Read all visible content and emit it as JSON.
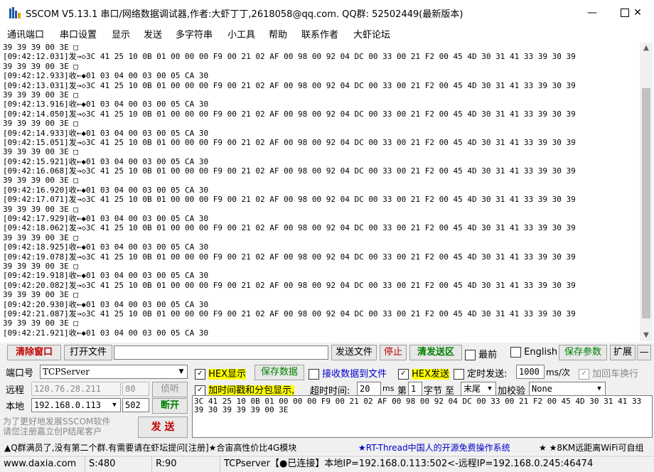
{
  "window": {
    "title": "SSCOM V5.13.1 串口/网络数据调试器,作者:大虾丁丁,2618058@qq.com. QQ群: 52502449(最新版本)",
    "minimize_glyph": "—",
    "maximize_glyph": "☐",
    "close_glyph": "✕"
  },
  "menu": [
    "通讯端口",
    "串口设置",
    "显示",
    "发送",
    "多字符串",
    "小工具",
    "帮助",
    "联系作者",
    "大虾论坛"
  ],
  "log": [
    "39 39 39 00 3E □",
    "[09:42:12.031]发→◇3C 41 25 10 0B 01 00 00 00 F9 00 21 02 AF 00 98 00 92 04 DC 00 33 00 21 F2 00 45 4D 30 31 41 33 39 30 39",
    "39 39 39 00 3E □",
    "[09:42:12.933]收←◆01 03 04 00 03 00 05 CA 30",
    "[09:42:13.031]发→◇3C 41 25 10 0B 01 00 00 00 F9 00 21 02 AF 00 98 00 92 04 DC 00 33 00 21 F2 00 45 4D 30 31 41 33 39 30 39",
    "39 39 39 00 3E □",
    "[09:42:13.916]收←◆01 03 04 00 03 00 05 CA 30",
    "[09:42:14.050]发→◇3C 41 25 10 0B 01 00 00 00 F9 00 21 02 AF 00 98 00 92 04 DC 00 33 00 21 F2 00 45 4D 30 31 41 33 39 30 39",
    "39 39 39 00 3E □",
    "[09:42:14.933]收←◆01 03 04 00 03 00 05 CA 30",
    "[09:42:15.051]发→◇3C 41 25 10 0B 01 00 00 00 F9 00 21 02 AF 00 98 00 92 04 DC 00 33 00 21 F2 00 45 4D 30 31 41 33 39 30 39",
    "39 39 39 00 3E □",
    "[09:42:15.921]收←◆01 03 04 00 03 00 05 CA 30",
    "[09:42:16.068]发→◇3C 41 25 10 0B 01 00 00 00 F9 00 21 02 AF 00 98 00 92 04 DC 00 33 00 21 F2 00 45 4D 30 31 41 33 39 30 39",
    "39 39 39 00 3E □",
    "[09:42:16.920]收←◆01 03 04 00 03 00 05 CA 30",
    "[09:42:17.071]发→◇3C 41 25 10 0B 01 00 00 00 F9 00 21 02 AF 00 98 00 92 04 DC 00 33 00 21 F2 00 45 4D 30 31 41 33 39 30 39",
    "39 39 39 00 3E □",
    "[09:42:17.929]收←◆01 03 04 00 03 00 05 CA 30",
    "[09:42:18.062]发→◇3C 41 25 10 0B 01 00 00 00 F9 00 21 02 AF 00 98 00 92 04 DC 00 33 00 21 F2 00 45 4D 30 31 41 33 39 30 39",
    "39 39 39 00 3E □",
    "[09:42:18.925]收←◆01 03 04 00 03 00 05 CA 30",
    "[09:42:19.078]发→◇3C 41 25 10 0B 01 00 00 00 F9 00 21 02 AF 00 98 00 92 04 DC 00 33 00 21 F2 00 45 4D 30 31 41 33 39 30 39",
    "39 39 39 00 3E □",
    "[09:42:19.918]收←◆01 03 04 00 03 00 05 CA 30",
    "[09:42:20.082]发→◇3C 41 25 10 0B 01 00 00 00 F9 00 21 02 AF 00 98 00 92 04 DC 00 33 00 21 F2 00 45 4D 30 31 41 33 39 30 39",
    "39 39 39 00 3E □",
    "[09:42:20.930]收←◆01 03 04 00 03 00 05 CA 30",
    "[09:42:21.087]发→◇3C 41 25 10 0B 01 00 00 00 F9 00 21 02 AF 00 98 00 92 04 DC 00 33 00 21 F2 00 45 4D 30 31 41 33 39 30 39",
    "39 39 39 00 3E □",
    "[09:42:21.921]收←◆01 03 04 00 03 00 05 CA 30"
  ],
  "toolbar": {
    "clear_window": "清除窗口",
    "open_file": "打开文件",
    "file_path": "",
    "send_file": "发送文件",
    "stop": "停止",
    "clear_send": "清发送区",
    "front_checked": false,
    "front": "最前",
    "english_checked": false,
    "english": "English",
    "save_params": "保存参数",
    "expand": "扩展",
    "collapse": "—"
  },
  "settings": {
    "port_label": "端口号",
    "port_value": "TCPServer",
    "remote_label": "远程",
    "remote_ip": "120.76.28.211",
    "remote_port": "80",
    "listen_btn": "侦听",
    "local_label": "本地",
    "local_ip": "192.168.0.113",
    "local_port": "502",
    "disconnect_btn": "断开",
    "hex_display_checked": true,
    "hex_display": "HEX显示",
    "save_data": "保存数据",
    "recv_to_file_checked": false,
    "recv_to_file": "接收数据到文件",
    "hex_send_checked": true,
    "hex_send": "HEX发送",
    "timed_send_checked": false,
    "timed_send": "定时发送:",
    "interval": "1000",
    "interval_unit": "ms/次",
    "add_crlf_checked": true,
    "add_crlf": "加回车换行",
    "timestamp_checked": true,
    "timestamp": "加时间戳和分包显示,",
    "timeout_label": "超时时间:",
    "timeout_value": "20",
    "timeout_unit": "ms",
    "nth_label": "第",
    "nth_value": "1",
    "byte_label": "字节 至",
    "end_value": "末尾",
    "checksum_label": "加校验",
    "checksum_value": "None",
    "promo_line1": "为了更好地发展SSCOM软件",
    "promo_line2": "请您注册嘉立创P结尾客户",
    "send_btn": "发 送",
    "send_text": "3C 41 25 10 0B 01 00 00 00 F9 00 21 02 AF 00 98 00 92 04 DC 00 33 00 21 F2 00 45 4D 30 31 41 33 39 30 39 39 39 00 3E"
  },
  "marquee": {
    "part1": "▲Q群满员了,没有第二个群.有需要请在虾坛提问[注册]★合宙高性价比4G模块",
    "part2": "★RT-Thread中国人的开源免费操作系统",
    "part3": "★ ★8KM远距离WiFi可自组"
  },
  "status": {
    "website": "www.daxia.com",
    "sent": "S:480",
    "received": "R:90",
    "connection": "TCPserver【●已连接】本地IP=192.168.0.113:502<-远程IP=192.168.0.245:46474"
  },
  "colors": {
    "accent_red": "#c00000",
    "accent_green": "#008000",
    "highlight_yellow": "#ffff00",
    "link_blue": "#0000cc"
  }
}
